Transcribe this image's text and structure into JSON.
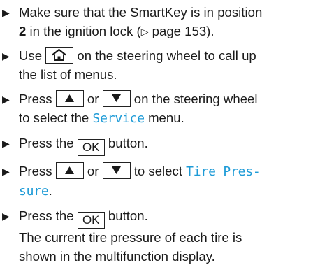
{
  "steps": [
    {
      "line1": "Make sure that the SmartKey is in position",
      "pos_num": "2",
      "line2_rest": " in the ignition lock (",
      "ref_arrow": "▷",
      "ref_page": " page 153)."
    },
    {
      "pre": "Use ",
      "post": " on the steering wheel to call up",
      "line2": "the list of menus."
    },
    {
      "pre": "Press ",
      "or": " or ",
      "post": " on the steering wheel",
      "line2_pre": "to select the ",
      "menu": "Service",
      "line2_post": " menu."
    },
    {
      "pre": "Press the ",
      "ok": "OK",
      "post": " button."
    },
    {
      "pre": "Press ",
      "or": " or ",
      "mid": " to select ",
      "menu_part1": "Tire Pres-",
      "menu_part2": "sure",
      "end": "."
    },
    {
      "pre": "Press the ",
      "ok": "OK",
      "post": " button.",
      "result_line1": "The current tire pressure of each tire is",
      "result_line2": "shown in the multifunction display."
    }
  ],
  "icons": {
    "bullet": "right-triangle-bullet",
    "home": "home-icon",
    "up": "up-arrow-icon",
    "down": "down-arrow-icon"
  }
}
